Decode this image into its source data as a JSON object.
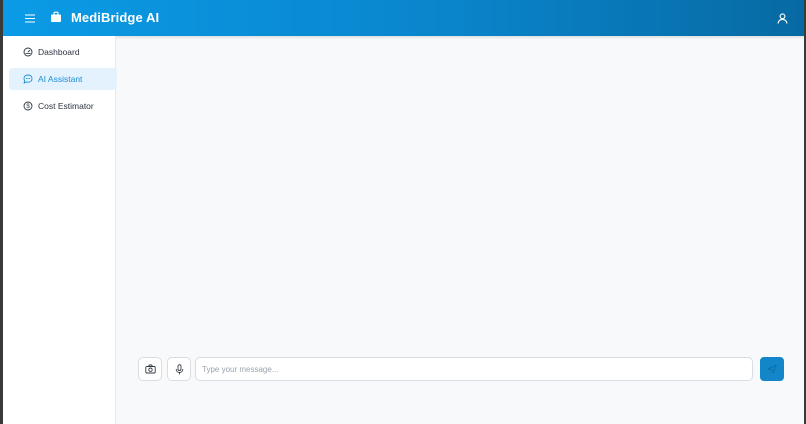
{
  "header": {
    "title": "MediBridge AI",
    "menu_icon": "hamburger-icon",
    "logo_icon": "briefcase-icon",
    "user_icon": "user-icon"
  },
  "sidebar": {
    "items": [
      {
        "label": "Dashboard",
        "icon": "gauge-icon",
        "active": false
      },
      {
        "label": "AI Assistant",
        "icon": "chat-icon",
        "active": true
      },
      {
        "label": "Cost Estimator",
        "icon": "dollar-icon",
        "active": false
      }
    ]
  },
  "composer": {
    "placeholder": "Type your message...",
    "value": "",
    "camera_icon": "camera-icon",
    "mic_icon": "microphone-icon",
    "send_icon": "send-icon"
  },
  "colors": {
    "brand": "#0b9be6",
    "brand_dark": "#076aa3",
    "active_bg": "#e3f2fd",
    "active_text": "#1b8ed6",
    "send_button": "#1286c8"
  }
}
